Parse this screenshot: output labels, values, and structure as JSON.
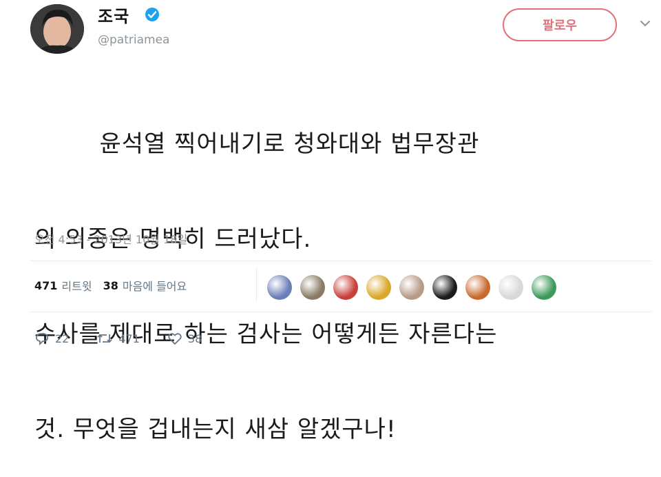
{
  "header": {
    "display_name": "조국",
    "handle": "@patriamea",
    "follow_label": "팔로우",
    "accent_color": "#e2717a",
    "verified_color": "#1da1f2"
  },
  "tweet": {
    "lines": [
      "        윤석열 찍어내기로 청와대와 법무장관",
      "의 의중은 명백히 드러났다.",
      "수사를 제대로 하는 검사는 어떻게든 자른다는",
      "것. 무엇을 겁내는지 새삼 알겠구나!"
    ],
    "timestamp": "오전 4:53 - 2013년 10월 18일"
  },
  "stats": {
    "retweets_count": "471",
    "retweets_label": "리트윗",
    "likes_count": "38",
    "likes_label": "마음에 들어요"
  },
  "actions": {
    "replies": "22",
    "retweets": "471",
    "likes": "38"
  },
  "likers": [
    {
      "color": "#6a7fb8"
    },
    {
      "color": "#8a7a66"
    },
    {
      "color": "#c8403a"
    },
    {
      "color": "#d9a72a"
    },
    {
      "color": "#b89a88"
    },
    {
      "color": "#1b1b1b"
    },
    {
      "color": "#c86a2e"
    },
    {
      "color": "#d8d8d8"
    },
    {
      "color": "#3e9a5a"
    }
  ]
}
